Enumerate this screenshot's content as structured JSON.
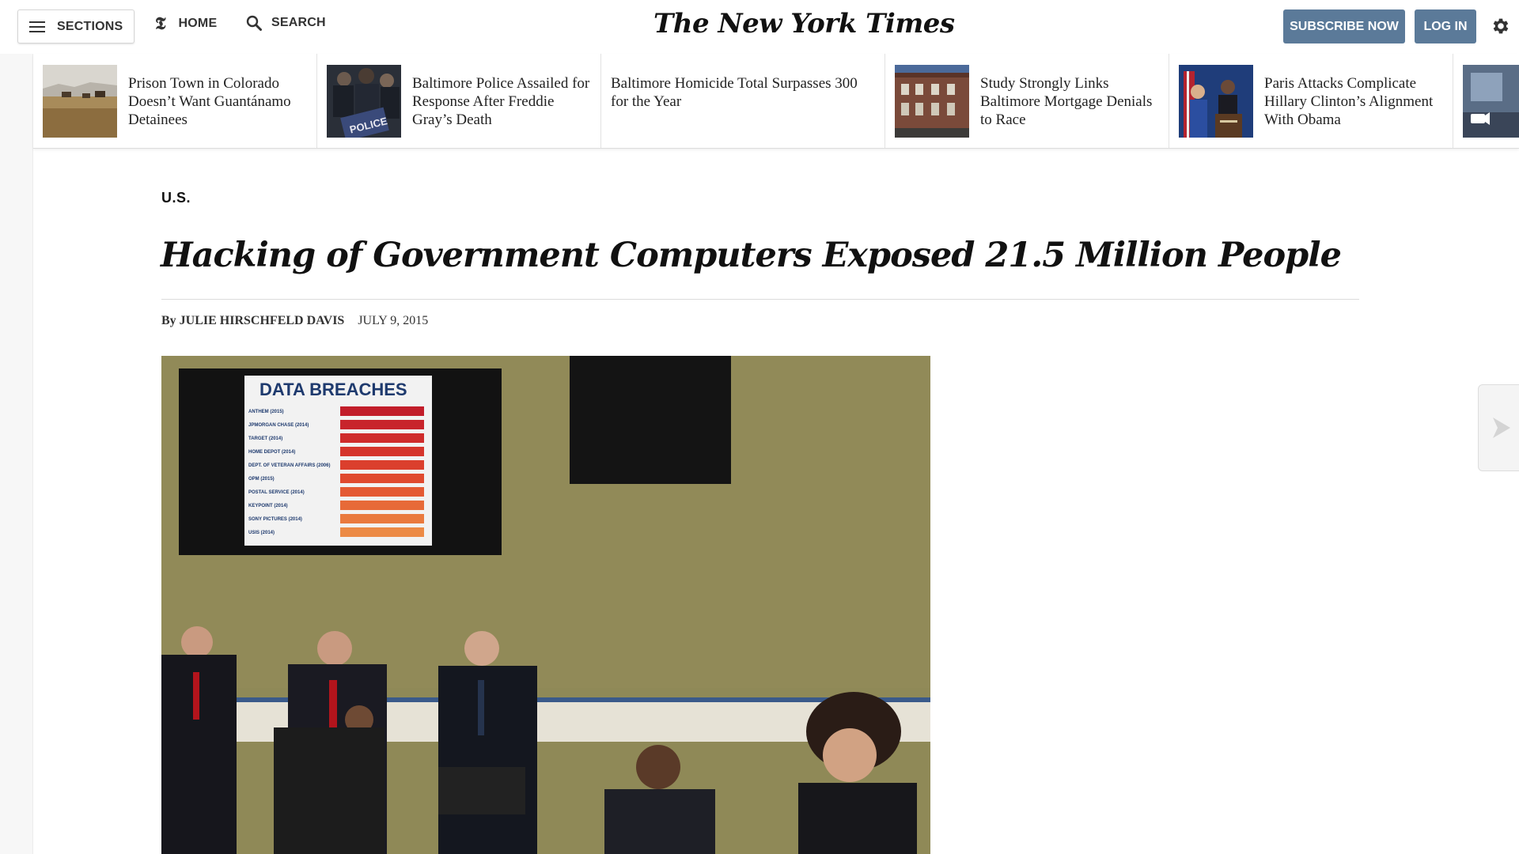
{
  "header": {
    "sections_label": "SECTIONS",
    "home_label": "HOME",
    "search_label": "SEARCH",
    "logo_text": "The New York Times",
    "subscribe_label": "SUBSCRIBE NOW",
    "login_label": "LOG IN",
    "accent_color": "#5b7a99"
  },
  "ribbon": [
    {
      "headline": "Prison Town in Colorado Doesn’t Want Guantánamo Detainees",
      "thumb": "prairie-cattle"
    },
    {
      "headline": "Baltimore Police Assailed for Response After Freddie Gray’s Death",
      "thumb": "police-crowd"
    },
    {
      "headline": "Baltimore Homicide Total Surpasses 300 for the Year",
      "thumb": ""
    },
    {
      "headline": "Study Strongly Links Baltimore Mortgage Denials to Race",
      "thumb": "rowhouses"
    },
    {
      "headline": "Paris Attacks Complicate Hillary Clinton’s Alignment With Obama",
      "thumb": "podium"
    }
  ],
  "article": {
    "section": "U.S.",
    "headline": "Hacking of Government Computers Exposed 21.5 Million People",
    "byline": "By JULIE HIRSCHFELD DAVIS",
    "date": "JULY 9, 2015"
  },
  "photo": {
    "screen_title": "DATA BREACHES",
    "screen_rows": [
      "ANTHEM (2015)",
      "JPMORGAN CHASE (2014)",
      "TARGET (2014)",
      "HOME DEPOT (2014)",
      "DEPT. OF VETERAN AFFAIRS (2006)",
      "OPM (2015)",
      "POSTAL SERVICE (2014)",
      "KEYPOINT (2014)",
      "SONY PICTURES (2014)",
      "USIS (2014)"
    ]
  }
}
